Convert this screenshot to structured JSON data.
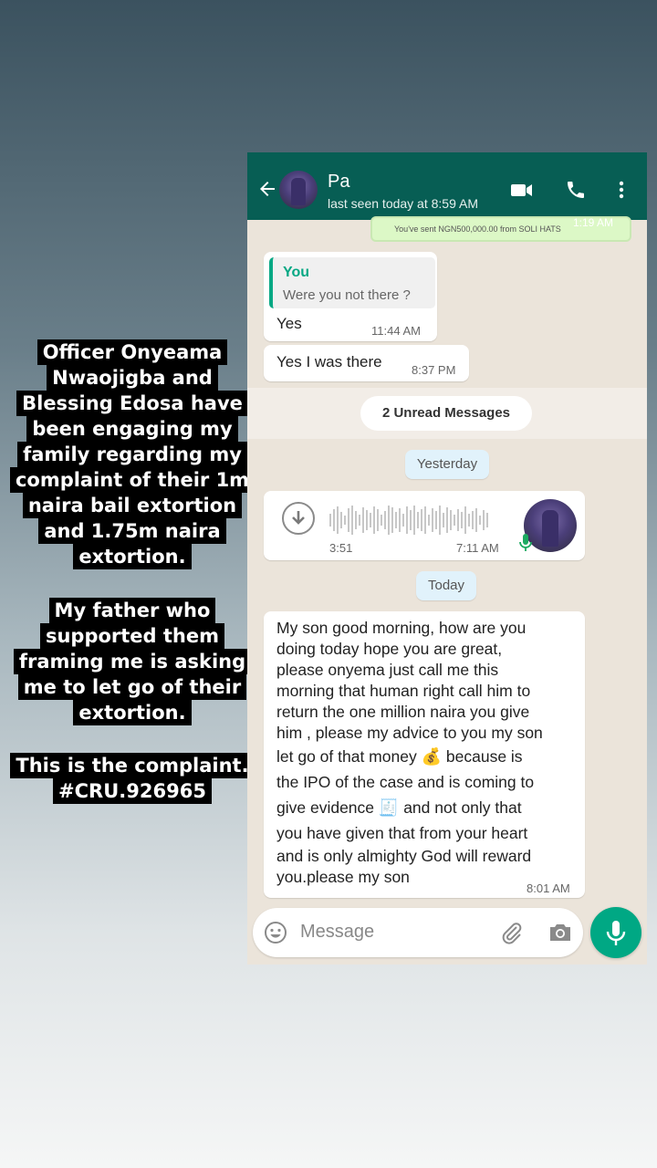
{
  "captions": {
    "block1": [
      "Officer Onyeama",
      "Nwaojigba and",
      "Blessing Edosa have",
      "been engaging my",
      "family regarding my",
      "complaint of their 1m",
      "naira bail extortion",
      "and 1.75m naira",
      "extortion."
    ],
    "block2": [
      "My father who",
      "supported them",
      "framing me is asking",
      "me to let go of their",
      "extortion."
    ],
    "block3": [
      "This is the complaint.",
      "#CRU.926965"
    ]
  },
  "chat_header": {
    "contact_name": "Pa",
    "last_seen": "last seen today at 8:59 AM"
  },
  "messages": {
    "top_partial": {
      "text": "You've sent NGN500,000.00 from SOLI HATS",
      "time": "1:19 AM"
    },
    "reply": {
      "quote_author": "You",
      "quote_text": "Were you not there ?",
      "text": "Yes",
      "time": "11:44 AM"
    },
    "msg2": {
      "text": "Yes I was there",
      "time": "8:37 PM"
    },
    "unread": "2 Unread Messages",
    "date1": "Yesterday",
    "voice": {
      "duration": "3:51",
      "time": "7:11 AM"
    },
    "date2": "Today",
    "long": {
      "lines": [
        "My son good morning, how are you",
        "doing today hope you are great,",
        "please onyema just call me this",
        "morning that human right call him to",
        "return the one million naira you give",
        "him , please my advice to you my son"
      ],
      "line7a": "let go of that money",
      "emoji1": "💰",
      "line7b": "because is",
      "line8": "the IPO of the case and is coming to",
      "line9a": "give evidence",
      "emoji2": "🧾",
      "line9b": "and not only that",
      "lines_end": [
        "you have given that from your heart",
        "and is only almighty God will reward",
        "you.please my son"
      ],
      "time": "8:01 AM"
    }
  },
  "composer": {
    "placeholder": "Message"
  },
  "colors": {
    "header": "#075e54",
    "accent": "#00a884",
    "quote_bar": "#06a884",
    "chat_bg": "#ebe4da"
  },
  "icons": [
    "back-arrow-icon",
    "video-call-icon",
    "phone-icon",
    "more-options-icon",
    "download-icon",
    "mic-icon",
    "emoji-icon",
    "attach-icon",
    "camera-icon"
  ]
}
